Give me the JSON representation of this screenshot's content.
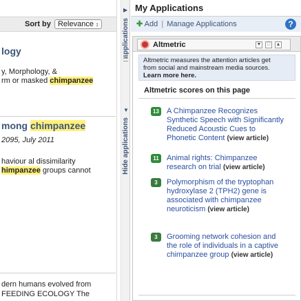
{
  "results": {
    "sort_label": "Sort by",
    "sort_value": "Relevance",
    "sort_arrows": "⬍",
    "item1_title": "logy",
    "item1_line1": "y, Morphology, &",
    "item1_line2_pre": "rm or masked ",
    "item1_line2_hl": "chimpanzee",
    "item2_title_pre": "mong ",
    "item2_title_hl": "chimpanzee",
    "item2_citation": "2095, July 2011",
    "item2_line1": "haviour al dissimilarity",
    "item2_line2_hl": "himpanzee",
    "item2_line2_post": " groups cannot",
    "item3_line1": "dern humans evolved from",
    "item3_line2": "FEEDING ECOLOGY The"
  },
  "hide_tab": {
    "label": "Hide applications"
  },
  "apps": {
    "title": "My Applications",
    "add_label": "Add",
    "manage_label": "Manage Applications",
    "help_symbol": "?",
    "widget": {
      "title": "Altmetric",
      "description_1": "Altmetric measures the attention articles get",
      "description_2": "from social and mainstream media sources.",
      "learn_more": "Learn more here.",
      "section_title": "Altmetric scores on this page",
      "articles": [
        {
          "score": "13",
          "title": "A Chimpanzee Recognizes Synthetic Speech with Significantly Reduced Acoustic Cues to Phonetic Content",
          "view": "(view article)"
        },
        {
          "score": "11",
          "title": "Animal rights: Chimpanzee research on trial",
          "view": "(view article)"
        },
        {
          "score": "3",
          "title": "Polymorphism of the tryptophan hydroxylase 2 (TPH2) gene is associated with chimpanzee neuroticism",
          "view": "(view article)"
        },
        {
          "score": "3",
          "title": "Grooming network cohesion and the role of individuals in a captive chimpanzee group",
          "view": "(view article)"
        }
      ]
    }
  },
  "colors": {
    "link": "#2a4fa0",
    "heading": "#3d5478",
    "highlight": "#fff07a",
    "badge": "#2e8b3a"
  }
}
